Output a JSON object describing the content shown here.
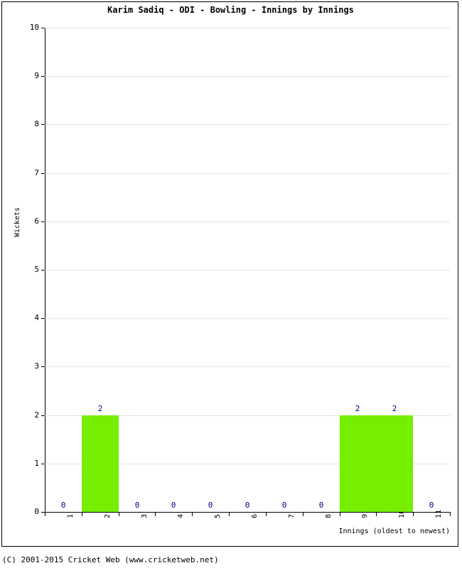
{
  "chart_data": {
    "type": "bar",
    "title": "Karim Sadiq - ODI - Bowling - Innings by Innings",
    "xlabel": "Innings (oldest to newest)",
    "ylabel": "Wickets",
    "categories": [
      "1",
      "2",
      "3",
      "4",
      "5",
      "6",
      "7",
      "8",
      "9",
      "10",
      "11"
    ],
    "values": [
      0,
      2,
      0,
      0,
      0,
      0,
      0,
      0,
      2,
      2,
      0
    ],
    "data_labels": [
      "0",
      "2",
      "0",
      "0",
      "0",
      "0",
      "0",
      "0",
      "2",
      "2",
      "0"
    ],
    "ylim": [
      0,
      10
    ],
    "yticks": [
      0,
      1,
      2,
      3,
      4,
      5,
      6,
      7,
      8,
      9,
      10
    ],
    "ytick_labels": [
      "0",
      "1",
      "2",
      "3",
      "4",
      "5",
      "6",
      "7",
      "8",
      "9",
      "10"
    ],
    "grid": true,
    "legend": false,
    "bar_color": "#76ee00",
    "label_color": "#000080",
    "gridline_color": "#e2e2e2",
    "axis_color": "#000000"
  },
  "footer": {
    "copyright": "(C) 2001-2015 Cricket Web (www.cricketweb.net)"
  }
}
